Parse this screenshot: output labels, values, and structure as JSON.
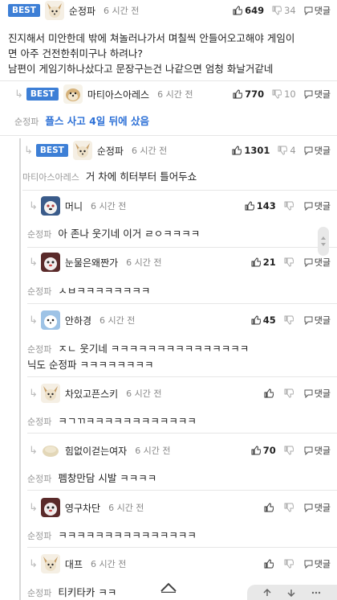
{
  "comments": [
    {
      "best": "BEST",
      "nick": "순정파",
      "time": "6 시간 전",
      "likes": "649",
      "dislikes": "34",
      "reply": "댓글",
      "text": [
        "진지해서 미안한데 밖에 쳐놀러나가서 며칠씩 안들어오고해야 게임이",
        "면 아주 건전한취미구나 하려나?",
        "남편이 게임기하나샀다고 문장구는건 나같으면 엄청 화날거같네"
      ]
    },
    {
      "best": "BEST",
      "nick": "마티아스아레스",
      "time": "6 시간 전",
      "likes": "770",
      "dislikes": "10",
      "reply": "댓글",
      "mention": "순정파",
      "text": "플스 사고 4일 뒤에 샀음"
    },
    {
      "best": "BEST",
      "nick": "순정파",
      "time": "6 시간 전",
      "likes": "1301",
      "dislikes": "4",
      "reply": "댓글",
      "mention": "마티아스아레스",
      "text": "거 차에 히터부터 틀어두쇼"
    },
    {
      "nick": "머니",
      "time": "6 시간 전",
      "likes": "143",
      "reply": "댓글",
      "mention": "순정파",
      "text": "아 존나 웃기네 이거 ㄹㅇㅋㅋㅋㅋ"
    },
    {
      "nick": "눈물은왜짠가",
      "time": "6 시간 전",
      "likes": "21",
      "reply": "댓글",
      "mention": "순정파",
      "text": "ㅅㅂㅋㅋㅋㅋㅋㅋㅋㅋ"
    },
    {
      "nick": "안하경",
      "time": "6 시간 전",
      "likes": "45",
      "reply": "댓글",
      "mention": "순정파",
      "text": [
        "ㅈㄴ 웃기네 ㅋㅋㅋㅋㅋㅋㅋㅋㅋㅋㅋㅋㅋㅋㅋ",
        "닉도 순정파 ㅋㅋㅋㅋㅋㅋㅋㅋ"
      ]
    },
    {
      "nick": "차있고픈스키",
      "time": "6 시간 전",
      "likes": "",
      "reply": "댓글",
      "mention": "순정파",
      "text": "ㅋㄱㄲㅋㅋㅋㅋㅋㅋㅋㅋㅋㅋㅋㅋ"
    },
    {
      "nick": "힘없이걷는여자",
      "time": "6 시간 전",
      "likes": "70",
      "reply": "댓글",
      "mention": "순정파",
      "text": "펨창만담 시발 ㅋㅋㅋㅋ"
    },
    {
      "nick": "영구차단",
      "time": "6 시간 전",
      "likes": "",
      "reply": "댓글",
      "mention": "순정파",
      "text": "ㅋㅋㅋㅋㅋㅋㅋㅋㅋㅋㅋㅋㅋㅋㅋ"
    },
    {
      "nick": "대프",
      "time": "6 시간 전",
      "likes": "",
      "reply": "댓글",
      "mention": "순정파",
      "text": "티키타카 ㅋㅋ"
    }
  ],
  "colors": {
    "accent": "#3d7fd6",
    "link": "#2b6fd6"
  },
  "icons": {
    "like": "thumbs-up-icon",
    "dislike": "thumbs-down-icon",
    "reply": "reply-icon",
    "scroll_top": "chevron-up-icon"
  }
}
